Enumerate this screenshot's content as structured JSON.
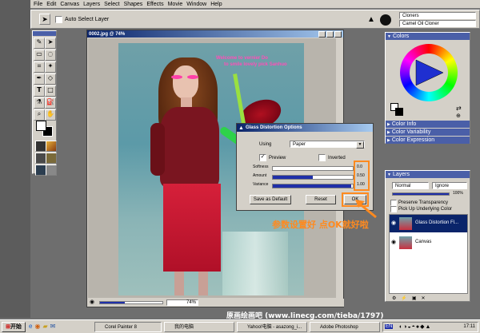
{
  "menu": [
    "File",
    "Edit",
    "Canvas",
    "Layers",
    "Select",
    "Shapes",
    "Effects",
    "Movie",
    "Window",
    "Help"
  ],
  "props": {
    "auto_select_label": "Auto Select Layer"
  },
  "brush": {
    "category": "Cloners",
    "variant": "Camel Oil Cloner"
  },
  "document": {
    "title": "0002.jpg @ 74%",
    "zoom": "74%",
    "poster_text_line1": "Welcome to vernier Do",
    "poster_text_line2": "to smile lovely pick Sanhuo"
  },
  "dialog": {
    "title": "Glass Distortion Options",
    "using_label": "Using",
    "using_value": "Paper",
    "preview_label": "Preview",
    "inverted_label": "Inverted",
    "sliders": [
      {
        "label": "Softness",
        "value": "0.0",
        "fraction": 0.0
      },
      {
        "label": "Amount",
        "value": "0.50",
        "fraction": 0.5
      },
      {
        "label": "Variance",
        "value": "1.00",
        "fraction": 0.98
      }
    ],
    "save_label": "Save as Default",
    "reset_label": "Reset",
    "ok_label": "OK"
  },
  "annotation": "参数设置好 点OK就好啦",
  "colors_panel": {
    "title": "Colors",
    "color_info": "Color Info",
    "color_variability": "Color Variability",
    "color_expression": "Color Expression"
  },
  "layers_panel": {
    "title": "Layers",
    "composite": "Normal",
    "depth": "Ignore",
    "opacity": "100%",
    "preserve": "Preserve Transparency",
    "pick_up": "Pick Up Underlying Color",
    "layers": [
      {
        "name": "Glass Distortion Fl..."
      },
      {
        "name": "Canvas"
      }
    ]
  },
  "watermark": "原画绘画吧 (www.linecg.com/tieba/1797)",
  "taskbar": {
    "start": "开始",
    "tasks": [
      "Corel Painter 8",
      "我的电脑",
      "Yahoo!电脑 - asazong_i...",
      "Adobe Photoshop"
    ],
    "clock": "17:11",
    "lang": "EN"
  },
  "colors": {
    "accent": "#ff8a1f",
    "title_blue": "#0a246a",
    "pink": "#ff4fb8"
  }
}
